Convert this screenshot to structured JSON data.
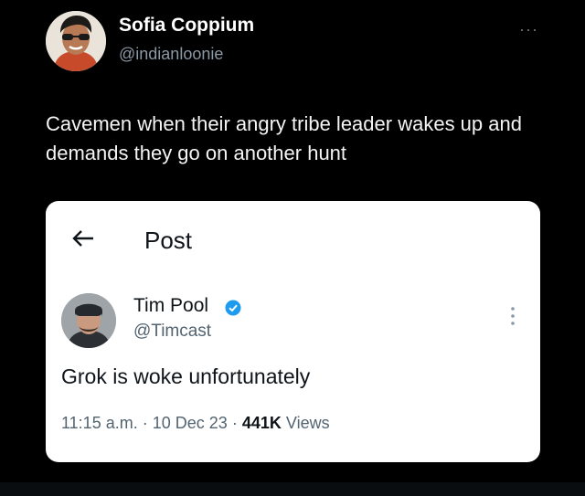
{
  "tweet": {
    "author_name": "Sofia Coppium",
    "author_handle": "@indianloonie",
    "more_label": "···",
    "text": "Cavemen when their angry tribe leader wakes up and demands they go on another hunt"
  },
  "embedded_post": {
    "header_title": "Post",
    "author_name": "Tim Pool",
    "author_handle": "@Timcast",
    "text": "Grok is woke unfortunately",
    "time": "11:15 a.m.",
    "separator": "·",
    "date": "10 Dec 23",
    "view_count": "441K",
    "views_label": "Views",
    "verified_color": "#1d9bf0"
  },
  "colors": {
    "background": "#000000",
    "card_background": "#ffffff",
    "secondary_text": "#536471",
    "verified_badge": "#1d9bf0"
  }
}
